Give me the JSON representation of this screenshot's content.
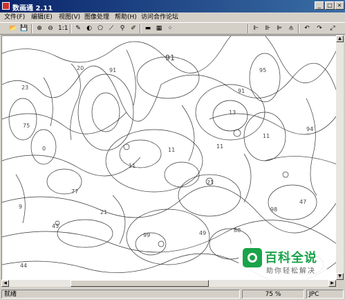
{
  "window": {
    "title": "数画通 2.11"
  },
  "menu": [
    "文件(F)",
    "编辑(E)",
    "视图(V)",
    "图像处理",
    "帮助(H)",
    "访问合作论坛"
  ],
  "toolbar": {
    "zoom_actual_label": "1:1"
  },
  "canvas": {
    "region_numbers": [
      "91",
      "20",
      "95",
      "23",
      "91",
      "91",
      "75",
      "11",
      "13",
      "0",
      "11",
      "9",
      "21",
      "99",
      "49",
      "88",
      "98",
      "44",
      "47",
      "94",
      "43",
      "21",
      "11",
      "11",
      "77"
    ]
  },
  "status": {
    "left": "就绪",
    "zoom": "75 %",
    "right": "JPC"
  },
  "watermark": {
    "title": "百科全说",
    "subtitle": "助你轻松解决"
  }
}
